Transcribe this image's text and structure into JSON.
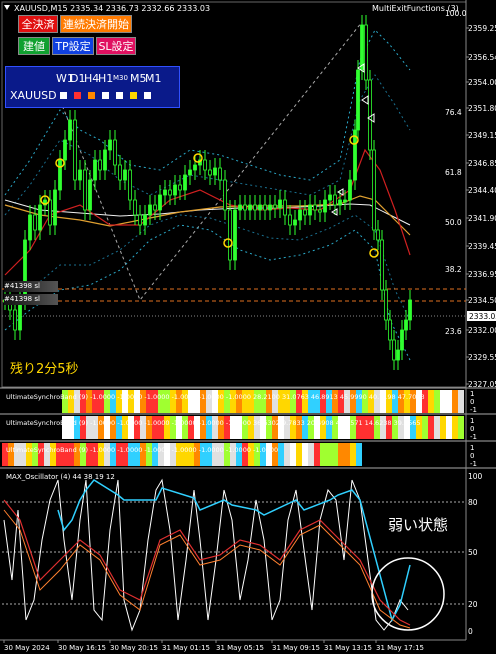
{
  "header": {
    "symbol_info": "XAUUSD,M15  2335.34 2336.73 2332.66 2333.03",
    "indicator_name": "MultiExitFunctions (3)"
  },
  "buttons": {
    "close_all": "全決済",
    "continuous": "連続決済開始",
    "position": "建値",
    "tp_set": "TP設定",
    "sl_set": "SL設定"
  },
  "timeframe_panel": {
    "timeframes": [
      "W1",
      "D1",
      "H4",
      "H1",
      "M30",
      "M5",
      "M1"
    ],
    "symbol": "XAUUSD",
    "colors": {
      "white": "#ffffff",
      "red": "#ff3030",
      "orange": "#ff8800",
      "yellow": "#ffd700"
    }
  },
  "order_lines": {
    "line1": "#41398 sl",
    "line2": "#41398 sl"
  },
  "countdown": "残り2分5秒",
  "price_axis": {
    "labels": [
      "2359.25",
      "2356.54",
      "2354.00",
      "2351.80",
      "2349.15",
      "2346.85",
      "2344.40",
      "2341.90",
      "2339.45",
      "2336.95",
      "2334.50",
      "2333.03",
      "2332.00",
      "2329.55",
      "2327.05"
    ],
    "current": "2333.03",
    "percent_labels": [
      "100.0",
      "76.4",
      "61.8",
      "50.0",
      "38.2",
      "23.6"
    ]
  },
  "subpanels": {
    "usb1": {
      "label": "UltimateSynchroBand (9) -1.0000 -1.0000 -1.0000 -1.0000 -1.0000 -1.0000 28.2100 31.0763 46.8913 45.9990 40.7198 47.7013",
      "levels": [
        "1",
        "0",
        "-1"
      ]
    },
    "usb2": {
      "label": "UltimateSynchroBand (9) -1.0000 -1.0000 -1.0000 -1.0000 -1.0000 -1.0000 36.6302 9.7833 20.4908 47.8571 14.6238 39.4565",
      "levels": [
        "1",
        "0",
        "-1"
      ]
    },
    "usb3": {
      "label": "UltimateSynchroBand (9) -1.0000 -1.0000 -1.0000 -1.0000 -1.0000 -1.0000 -1.0000",
      "levels": [
        "1",
        "0",
        "-1"
      ]
    },
    "osc": {
      "label": "MAX_Oscillator (4) 44 38 19 12",
      "levels": [
        "100",
        "80",
        "50",
        "20",
        "0"
      ],
      "annotation": "弱い状態"
    }
  },
  "time_axis": [
    "30 May 2024",
    "30 May 16:15",
    "30 May 20:15",
    "31 May 01:15",
    "31 May 05:15",
    "31 May 09:15",
    "31 May 13:15",
    "31 May 17:15"
  ]
}
